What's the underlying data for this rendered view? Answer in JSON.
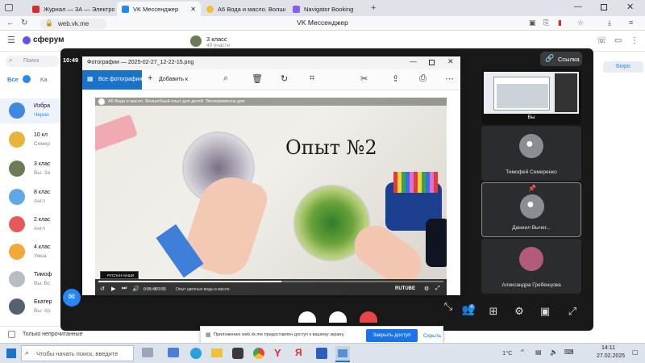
{
  "browser": {
    "tabs": [
      {
        "label": "Журнал — 3А — Электро",
        "color": "#d62c2c",
        "active": false
      },
      {
        "label": "VK Мессенджер",
        "color": "#2787f5",
        "active": true
      },
      {
        "label": "А6 Вода и масло. Волше",
        "color": "#f0c22a",
        "active": false
      },
      {
        "label": "Navigator Booking",
        "color": "#8a5cf0",
        "active": false
      }
    ],
    "new_tab": "+",
    "url": "web.vk.me",
    "page_title": "VK Мессенджер"
  },
  "vk": {
    "logo": "сферум",
    "search_placeholder": "Поиск",
    "filter_all": "Все",
    "filter_second": "Ка",
    "header_chat_title": "3 класс",
    "header_chat_sub": "49 участн",
    "chats": [
      {
        "title": "Избра",
        "sub": "Черно",
        "color": "#3f8ae0"
      },
      {
        "title": "10 кл",
        "sub": "Семер",
        "color": "#e8b53a"
      },
      {
        "title": "3 клас",
        "sub": "Вы: За",
        "color": "#6b7b55"
      },
      {
        "title": "8 клас",
        "sub": "Англ",
        "color": "#5ea8e6"
      },
      {
        "title": "2 клас",
        "sub": "Англ",
        "color": "#e85a5a"
      },
      {
        "title": "4 клас",
        "sub": "Умна",
        "color": "#f2a93a"
      },
      {
        "title": "Тимоф",
        "sub": "Вы: Вс",
        "color": "#b8bcc4"
      },
      {
        "title": "Екатер",
        "sub": "Вы: Хр",
        "color": "#556070"
      }
    ],
    "only_unread": "Только непрочитанные",
    "right_btn": "Бюро"
  },
  "call": {
    "time": "10:49",
    "link_label": "Ссылка",
    "participants": [
      {
        "name": "Вы",
        "type": "screen"
      },
      {
        "name": "Тимофей Семеренко",
        "type": "avatar"
      },
      {
        "name": "Даниил Вычег...",
        "type": "avatar"
      },
      {
        "name": "Александра Гребенцова",
        "type": "photo"
      }
    ],
    "people_count": "4"
  },
  "photo": {
    "title": "Фотографии — 2025-02-27_12-22-15.png",
    "all_photos": "Все фотографии",
    "add_to": "Добавить к",
    "video_title": "А6 Вода и масло. Волшебный опыт для детей. Эксперименты для",
    "overlay_text": "Опыт №2",
    "watermark": "РУСЛАН НАШИ",
    "progress": 0.53,
    "player_time": "0:05:48/3:55",
    "player_caption": "Опыт цветные воды и масло",
    "player_brand": "RUTUBE"
  },
  "notice": {
    "text": "Приложению web.vk.me предоставлен доступ к вашему экрану.",
    "close_btn": "Закрыть доступ",
    "hide_btn": "Скрыть"
  },
  "taskbar": {
    "search_placeholder": "Чтобы начать поиск, введите",
    "weather": "1°С",
    "time": "14:11",
    "date": "27.02.2025"
  }
}
